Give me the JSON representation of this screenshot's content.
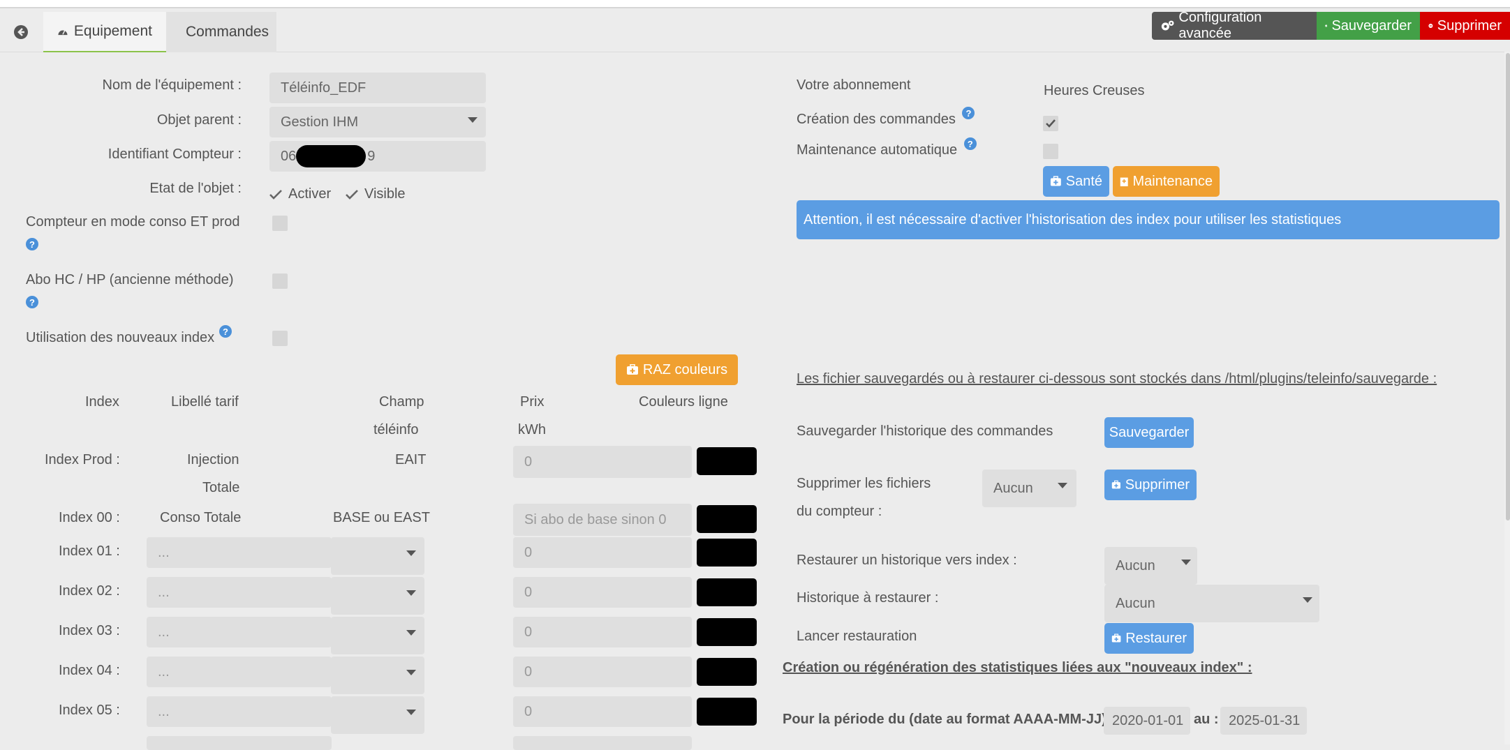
{
  "tabs": {
    "equipement": "Equipement",
    "commandes": "Commandes"
  },
  "top_buttons": {
    "config": "Configuration avancée",
    "save": "Sauvegarder",
    "delete": "Supprimer"
  },
  "colors": {
    "blue": "#5b9de3",
    "orange": "#f0a030",
    "green": "#43a047",
    "red": "#d50000",
    "dark": "#555555"
  },
  "form": {
    "nom_label": "Nom de l'équipement :",
    "nom_value": "Téléinfo_EDF",
    "objet_label": "Objet parent :",
    "objet_value": "Gestion IHM",
    "compteur_label": "Identifiant Compteur :",
    "compteur_prefix": "06",
    "compteur_suffix": "9",
    "etat_label": "Etat de l'objet :",
    "activer": "Activer",
    "visible": "Visible",
    "conso_prod_label": "Compteur en mode conso ET prod",
    "abo_label": "Abo HC / HP (ancienne méthode)",
    "nouveaux_label": "Utilisation des nouveaux index"
  },
  "right": {
    "abonnement_label": "Votre abonnement",
    "abonnement_value": "Heures Creuses",
    "creation_label": "Création des commandes",
    "maintenance_label": "Maintenance automatique",
    "sante_btn": "Santé",
    "maintenance_btn": "Maintenance",
    "alert": "Attention, il est nécessaire d'activer l'historisation des index pour utiliser les statistiques"
  },
  "index_table": {
    "raz_btn": "RAZ couleurs",
    "h_index": "Index",
    "h_libelle": "Libellé tarif",
    "h_champ1": "Champ",
    "h_champ2": "téléinfo",
    "h_prix1": "Prix",
    "h_prix2": "kWh",
    "h_couleurs": "Couleurs ligne",
    "prod_label": "Index Prod :",
    "prod_lib1": "Injection",
    "prod_lib2": "Totale",
    "prod_champ": "EAIT",
    "prod_prix": "0",
    "i00_label": "Index 00 :",
    "i00_lib": "Conso Totale",
    "i00_champ": "BASE ou EAST",
    "i00_prix": "Si abo de base sinon 0",
    "rows": [
      {
        "label": "Index 01 :",
        "lib": "...",
        "prix": "0"
      },
      {
        "label": "Index 02 :",
        "lib": "...",
        "prix": "0"
      },
      {
        "label": "Index 03 :",
        "lib": "...",
        "prix": "0"
      },
      {
        "label": "Index 04 :",
        "lib": "...",
        "prix": "0"
      },
      {
        "label": "Index 05 :",
        "lib": "...",
        "prix": "0"
      }
    ]
  },
  "backup": {
    "info": "Les fichier sauvegardés ou à restaurer ci-dessous sont stockés dans /html/plugins/teleinfo/sauvegarde :",
    "save_label": "Sauvegarder l'historique des commandes",
    "save_btn": "Sauvegarder",
    "del_label1": "Supprimer les fichiers",
    "del_label2": "du compteur :",
    "del_select": "Aucun",
    "del_btn": "Supprimer",
    "restore_label": "Restaurer un historique vers index :",
    "restore_select": "Aucun",
    "hist_label": "Historique à restaurer :",
    "hist_select": "Aucun",
    "launch_label": "Lancer restauration",
    "launch_btn": "Restaurer",
    "stats_title": "Création ou régénération des statistiques liées aux \"nouveaux index\" :",
    "period_label": "Pour la période du (date au format AAAA-MM-JJ) :",
    "date_from": "2020-01-01",
    "au": "au :",
    "date_to": "2025-01-31"
  }
}
